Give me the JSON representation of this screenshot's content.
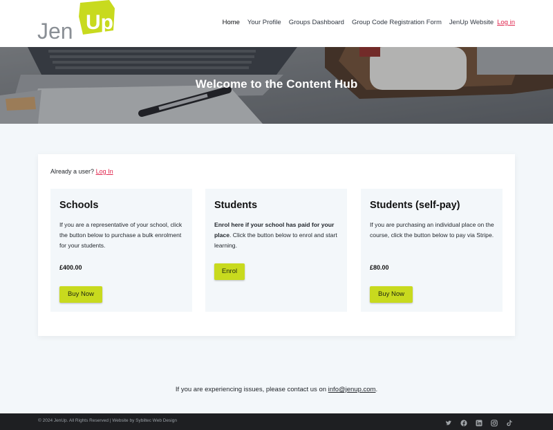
{
  "brand": {
    "logo_text": "JenUp",
    "accent": "#c8da1e",
    "link_color": "#e0254d"
  },
  "nav": [
    {
      "label": "Home"
    },
    {
      "label": "Your Profile"
    },
    {
      "label": "Groups Dashboard"
    },
    {
      "label": "Group Code Registration Form"
    },
    {
      "label": "JenUp Website"
    },
    {
      "label": "Log in"
    }
  ],
  "hero": {
    "title": "Welcome to the Content Hub"
  },
  "panel": {
    "already_text": "Already a user?",
    "login_link": "Log In",
    "cards": [
      {
        "title": "Schools",
        "description": "If you are a representative of your school, click the button below to purchase a bulk enrolment for your students.",
        "price": "£400.00",
        "button": "Buy Now"
      },
      {
        "title": "Students",
        "description_bold": "Enrol here if your school has paid for your place",
        "description_rest": ". Click the button below to enrol and start learning.",
        "button": "Enrol"
      },
      {
        "title": "Students (self-pay)",
        "description": "If you are purchasing an individual place on the course, click the button below to pay via Stripe.",
        "price": "£80.00",
        "button": "Buy Now"
      }
    ]
  },
  "contact": {
    "text": "If you are experiencing issues, please contact us on",
    "email": "info@jenup.com",
    "suffix": "."
  },
  "footer": {
    "copyright": "© 2024 JenUp. All Rights Reserved | Website by Sybiltec Web Design",
    "socials": [
      "twitter-icon",
      "facebook-icon",
      "linkedin-icon",
      "instagram-icon",
      "tiktok-icon"
    ]
  }
}
